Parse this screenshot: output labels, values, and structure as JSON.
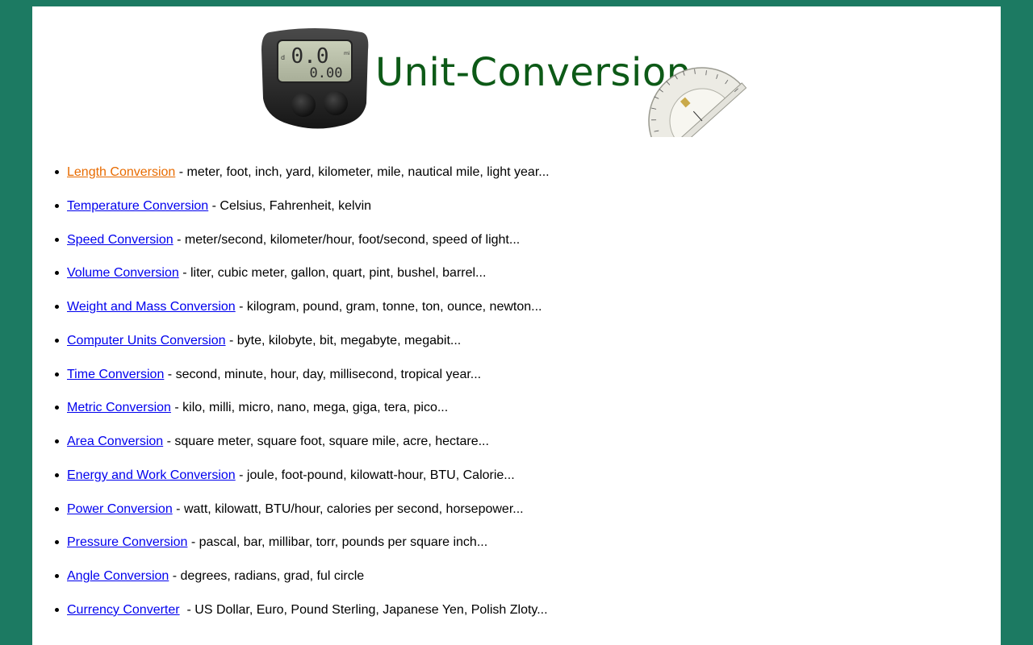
{
  "header": {
    "title": "Unit-Conversion",
    "odometer_display": {
      "top": "0.0",
      "bottom": "0.00",
      "left_char": "d",
      "unit": "mi"
    }
  },
  "colors": {
    "background": "#1c7a62",
    "title": "#0d5a17",
    "link": "#0000ee",
    "active_link": "#e86b00"
  },
  "links": [
    {
      "label": "Length Conversion",
      "desc": " - meter, foot, inch, yard, kilometer, mile, nautical mile, light year...",
      "active": true
    },
    {
      "label": "Temperature Conversion",
      "desc": " - Celsius, Fahrenheit, kelvin"
    },
    {
      "label": "Speed Conversion",
      "desc": " - meter/second, kilometer/hour, foot/second, speed of light..."
    },
    {
      "label": "Volume Conversion",
      "desc": " - liter, cubic meter, gallon, quart, pint, bushel, barrel..."
    },
    {
      "label": "Weight and Mass Conversion",
      "desc": " - kilogram, pound, gram, tonne, ton, ounce, newton..."
    },
    {
      "label": "Computer Units Conversion",
      "desc": " - byte, kilobyte, bit, megabyte, megabit..."
    },
    {
      "label": "Time Conversion",
      "desc": " - second, minute, hour, day, millisecond, tropical year..."
    },
    {
      "label": "Metric Conversion",
      "desc": " - kilo, milli, micro, nano, mega, giga, tera, pico..."
    },
    {
      "label": "Area Conversion",
      "desc": " - square meter, square foot, square mile, acre, hectare..."
    },
    {
      "label": "Energy and Work Conversion",
      "desc": " - joule, foot-pound, kilowatt-hour, BTU, Calorie..."
    },
    {
      "label": "Power Conversion",
      "desc": " - watt, kilowatt, BTU/hour, calories per second, horsepower..."
    },
    {
      "label": "Pressure Conversion",
      "desc": " - pascal, bar, millibar, torr, pounds per square inch..."
    },
    {
      "label": "Angle Conversion",
      "desc": " - degrees, radians, grad, ful circle"
    },
    {
      "label": "Currency Converter",
      "desc": "  - US Dollar, Euro, Pound Sterling, Japanese Yen, Polish Zloty..."
    }
  ]
}
